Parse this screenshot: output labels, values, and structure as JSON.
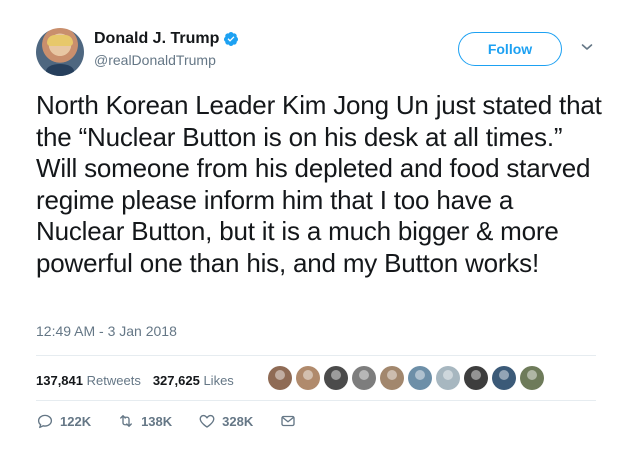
{
  "author": {
    "display_name": "Donald J. Trump",
    "handle": "@realDonaldTrump",
    "verified": true
  },
  "follow_label": "Follow",
  "tweet_text": "North Korean Leader Kim Jong Un just stated that the “Nuclear Button is on his desk at all times.” Will someone from his depleted and food starved regime please inform him that I too have a Nuclear Button, but it is a much bigger & more powerful one than his, and my Button works!",
  "timestamp": "12:49 AM - 3 Jan 2018",
  "stats": {
    "retweets_count": "137,841",
    "retweets_label": "Retweets",
    "likes_count": "327,625",
    "likes_label": "Likes"
  },
  "liker_colors": [
    "#8f6b55",
    "#b08a6c",
    "#4b4b4b",
    "#7d7d7d",
    "#a2876d",
    "#6d8fa8",
    "#a7b7c0",
    "#3d3d3d",
    "#3b5a78",
    "#6e7b5a"
  ],
  "actions": {
    "replies": "122K",
    "retweets": "138K",
    "likes": "328K"
  },
  "colors": {
    "accent": "#1da1f2",
    "text": "#14171a",
    "secondary": "#657786"
  },
  "icons": [
    "verified-badge-icon",
    "chevron-down-icon",
    "reply-icon",
    "retweet-icon",
    "heart-icon",
    "message-icon"
  ]
}
